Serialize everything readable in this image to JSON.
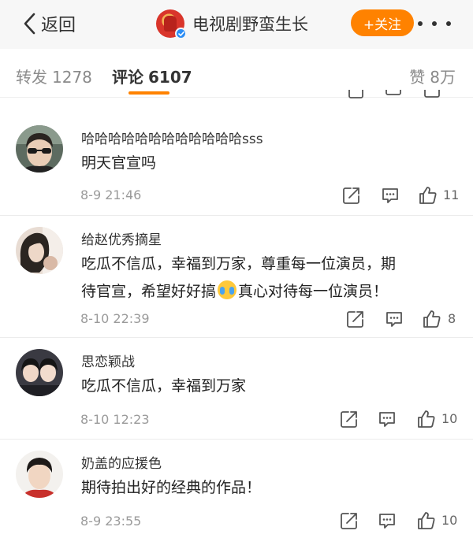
{
  "header": {
    "back_label": "返回",
    "channel_name": "电视剧野蛮生长",
    "follow_label": "+关注",
    "accent_color": "#ff8200"
  },
  "tabs": {
    "forward_label": "转发",
    "forward_count": "1278",
    "comment_label": "评论",
    "comment_count": "6107",
    "like_label": "赞",
    "like_count": "8万"
  },
  "comments": [
    {
      "author": "哈哈哈哈哈哈哈哈哈哈哈哈sss",
      "text_lines": [
        "明天官宣吗"
      ],
      "time": "8-9 21:46",
      "likes": "11",
      "avatar": "person-with-sunglasses"
    },
    {
      "author": "给赵优秀摘星",
      "text_lines": [
        "吃瓜不信瓜，幸福到万家，尊重每一位演员，期",
        "待官宣，希望好好搞",
        "真心对待每一位演员！"
      ],
      "emoji": "crying-face-emoji",
      "time": "8-10 22:39",
      "likes": "8",
      "avatar": "person-profile-photo"
    },
    {
      "author": "思恋颖战",
      "text_lines": [
        "吃瓜不信瓜，幸福到万家"
      ],
      "time": "8-10 12:23",
      "likes": "10",
      "avatar": "two-people-photo"
    },
    {
      "author": "奶盖的应援色",
      "text_lines": [
        "期待拍出好的经典的作品！"
      ],
      "time": "8-9 23:55",
      "likes": "10",
      "avatar": "young-man-photo"
    }
  ]
}
